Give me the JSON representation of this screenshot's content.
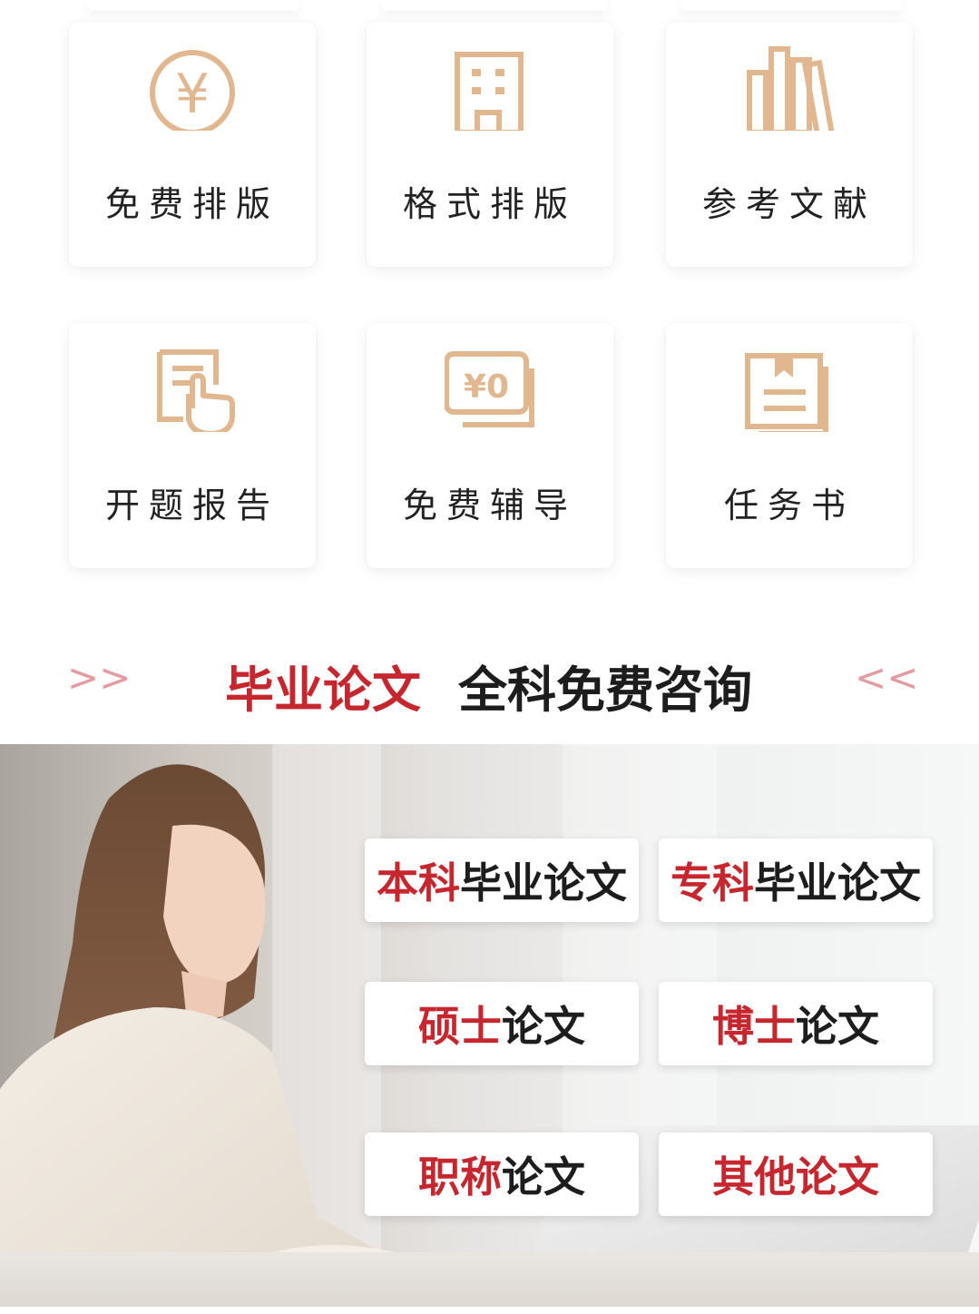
{
  "services": [
    {
      "label": "免费排版",
      "icon": "yen-coin-icon"
    },
    {
      "label": "格式排版",
      "icon": "building-icon"
    },
    {
      "label": "参考文献",
      "icon": "books-icon"
    },
    {
      "label": "开题报告",
      "icon": "document-hand-icon"
    },
    {
      "label": "免费辅导",
      "icon": "free-ticket-icon"
    },
    {
      "label": "任务书",
      "icon": "bookmark-document-icon"
    }
  ],
  "icon_text": {
    "yen": "¥",
    "zero": "¥0"
  },
  "heading": {
    "left_arrow": ">>",
    "highlight": "毕业论文",
    "text": "全科免费咨询",
    "right_arrow": "<<"
  },
  "categories": [
    {
      "highlight": "本科",
      "rest": "毕业论文"
    },
    {
      "highlight": "专科",
      "rest": "毕业论文"
    },
    {
      "highlight": "硕士",
      "rest": "论文"
    },
    {
      "highlight": "博士",
      "rest": "论文"
    },
    {
      "highlight": "职称",
      "rest": "论文"
    },
    {
      "highlight": "其他论文",
      "rest": ""
    }
  ],
  "colors": {
    "icon": "#e0b78f",
    "accent_red": "#c6262e",
    "arrow": "#e39aa0"
  }
}
